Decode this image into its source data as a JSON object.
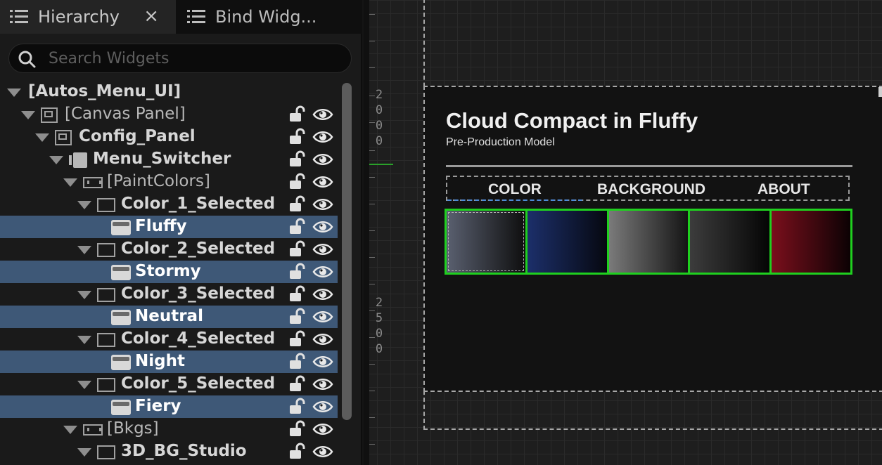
{
  "tabs": {
    "hierarchy": "Hierarchy",
    "close": "×",
    "bind": "Bind Widg..."
  },
  "search": {
    "placeholder": "Search Widgets"
  },
  "tree": [
    {
      "label": "[Autos_Menu_UI]",
      "depth": 0,
      "icon": "none",
      "style": "bold",
      "selected": false,
      "lock": false
    },
    {
      "label": "[Canvas Panel]",
      "depth": 1,
      "icon": "canvas-panel-icon",
      "style": "norm",
      "selected": false,
      "lock": true
    },
    {
      "label": "Config_Panel",
      "depth": 2,
      "icon": "canvas-panel-icon",
      "style": "bold",
      "selected": false,
      "lock": true
    },
    {
      "label": "Menu_Switcher",
      "depth": 3,
      "icon": "widget-switcher-icon",
      "style": "bold",
      "selected": false,
      "lock": true
    },
    {
      "label": "[PaintColors]",
      "depth": 4,
      "icon": "wrap-box-icon",
      "style": "norm",
      "selected": false,
      "lock": true
    },
    {
      "label": "Color_1_Selected",
      "depth": 5,
      "icon": "border-icon",
      "style": "bold",
      "selected": false,
      "lock": true
    },
    {
      "label": "Fluffy",
      "depth": 6,
      "icon": "image-icon",
      "style": "bold",
      "selected": true,
      "lock": true
    },
    {
      "label": "Color_2_Selected",
      "depth": 5,
      "icon": "border-icon",
      "style": "bold",
      "selected": false,
      "lock": true
    },
    {
      "label": "Stormy",
      "depth": 6,
      "icon": "image-icon",
      "style": "bold",
      "selected": true,
      "lock": true
    },
    {
      "label": "Color_3_Selected",
      "depth": 5,
      "icon": "border-icon",
      "style": "bold",
      "selected": false,
      "lock": true
    },
    {
      "label": "Neutral",
      "depth": 6,
      "icon": "image-icon",
      "style": "bold",
      "selected": true,
      "lock": true
    },
    {
      "label": "Color_4_Selected",
      "depth": 5,
      "icon": "border-icon",
      "style": "bold",
      "selected": false,
      "lock": true
    },
    {
      "label": "Night",
      "depth": 6,
      "icon": "image-icon",
      "style": "bold",
      "selected": true,
      "lock": true
    },
    {
      "label": "Color_5_Selected",
      "depth": 5,
      "icon": "border-icon",
      "style": "bold",
      "selected": false,
      "lock": true
    },
    {
      "label": "Fiery",
      "depth": 6,
      "icon": "image-icon",
      "style": "bold",
      "selected": true,
      "lock": true
    },
    {
      "label": "[Bkgs]",
      "depth": 4,
      "icon": "wrap-box-icon",
      "style": "norm",
      "selected": false,
      "lock": true
    },
    {
      "label": "3D_BG_Studio",
      "depth": 5,
      "icon": "border-icon",
      "style": "bold",
      "selected": false,
      "lock": true
    }
  ],
  "ruler": {
    "group_a": [
      "2",
      "0",
      "0",
      "0"
    ],
    "group_b": [
      "2",
      "5",
      "0",
      "0"
    ]
  },
  "widget": {
    "title": "Cloud Compact in Fluffy",
    "subtitle": "Pre-Production Model",
    "nav": [
      "COLOR",
      "BACKGROUND",
      "ABOUT"
    ],
    "swatches": [
      {
        "name": "Fluffy",
        "from": "#5a6070",
        "to": "#0e0e0e"
      },
      {
        "name": "Stormy",
        "from": "#1c2f6a",
        "to": "#060810"
      },
      {
        "name": "Neutral",
        "from": "#7a7a7a",
        "to": "#151515"
      },
      {
        "name": "Night",
        "from": "#3c3c3c",
        "to": "#050505"
      },
      {
        "name": "Fiery",
        "from": "#7a0f1c",
        "to": "#0c0204"
      }
    ],
    "selection_color": "#1fd01f",
    "accent_underline": "#4f8ad6"
  },
  "colors": {
    "selected_row": "#3e5877"
  }
}
